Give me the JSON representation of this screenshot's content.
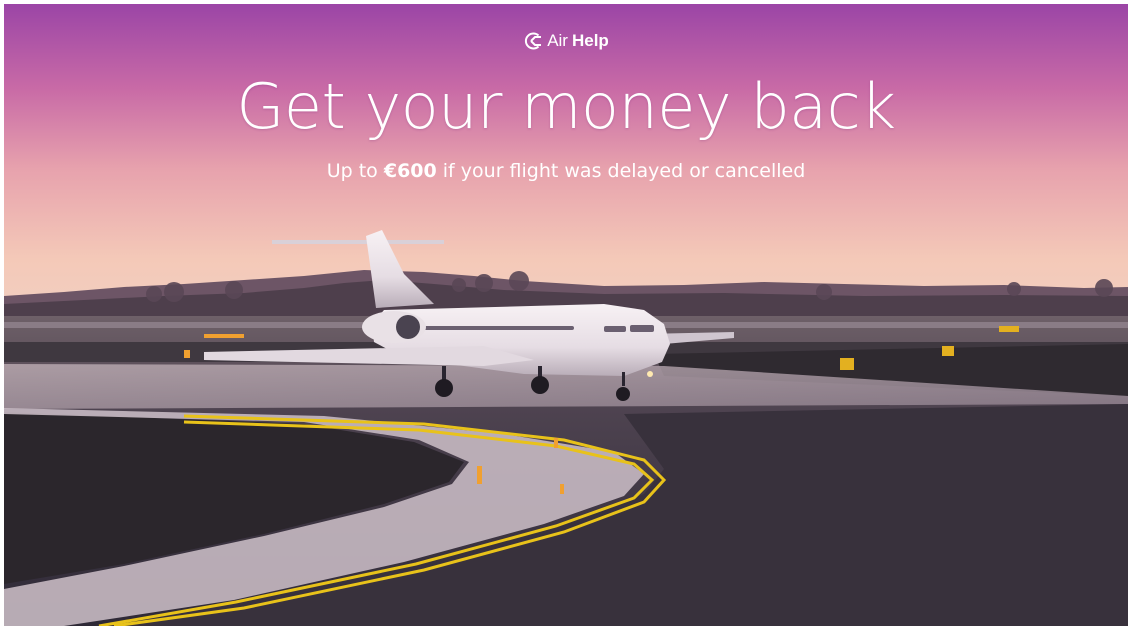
{
  "brand": {
    "air": "Air",
    "help": "Help",
    "icon": "airhelp-logo-icon"
  },
  "hero": {
    "headline": "Get your money back",
    "subtitle_prefix": "Up to ",
    "subtitle_amount": "€600",
    "subtitle_suffix": " if your flight was delayed or cancelled"
  },
  "colors": {
    "sky_top": "#a04ea8",
    "sky_mid": "#d88aa6",
    "sky_horizon": "#f3c3b3",
    "tarmac": "#3a3340",
    "grass": "#2f2a30",
    "taxi_line": "#e8c21a"
  }
}
